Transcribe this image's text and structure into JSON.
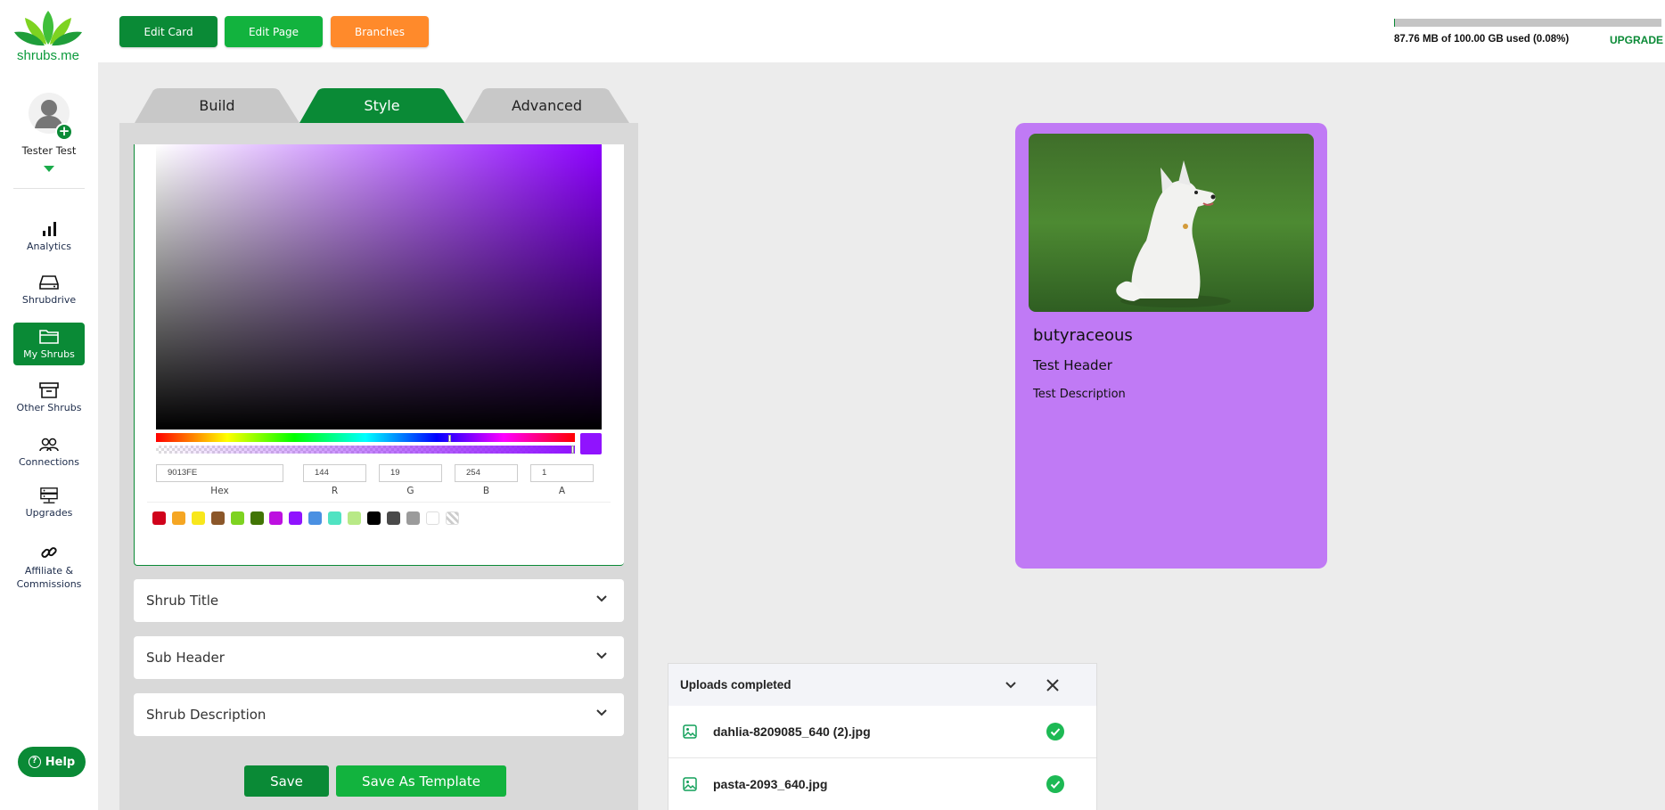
{
  "brand": {
    "logo_text": "shrubs.me"
  },
  "profile": {
    "name": "Tester Test"
  },
  "sidebar": {
    "items": [
      {
        "label": "Analytics"
      },
      {
        "label": "Shrubdrive"
      },
      {
        "label": "My Shrubs"
      },
      {
        "label": "Other Shrubs"
      },
      {
        "label": "Connections"
      },
      {
        "label": "Upgrades"
      },
      {
        "label": "Affiliate &",
        "label2": "Commissions"
      }
    ],
    "help_label": "Help"
  },
  "toolbar": {
    "edit_card": "Edit Card",
    "edit_page": "Edit Page",
    "branches": "Branches"
  },
  "storage": {
    "text": "87.76 MB of 100.00 GB used (0.08%)",
    "used_fraction": 0.0008,
    "upgrade_label": "UPGRADE"
  },
  "tabs": [
    {
      "label": "Build"
    },
    {
      "label": "Style"
    },
    {
      "label": "Advanced"
    }
  ],
  "color_picker": {
    "hex": "9013FE",
    "r": "144",
    "g": "19",
    "b": "254",
    "a": "1",
    "labels": {
      "hex": "Hex",
      "r": "R",
      "g": "G",
      "b": "B",
      "a": "A"
    },
    "selected_color": "#9013FE",
    "preset_colors": [
      "#D0021B",
      "#F5A623",
      "#F8E71C",
      "#8B572A",
      "#7ED321",
      "#417505",
      "#BD10E0",
      "#9013FE",
      "#4A90E2",
      "#50E3C2",
      "#B8E986",
      "#000000",
      "#4A4A4A",
      "#9B9B9B",
      "#FFFFFF",
      "transparent"
    ]
  },
  "sections": [
    {
      "label": "Shrub Title"
    },
    {
      "label": "Sub Header"
    },
    {
      "label": "Shrub Description"
    }
  ],
  "actions": {
    "save": "Save",
    "save_template": "Save As Template"
  },
  "card": {
    "background": "#C07AF5",
    "title": "butyraceous",
    "header": "Test Header",
    "description": "Test Description"
  },
  "uploads": {
    "title": "Uploads completed",
    "files": [
      {
        "name": "dahlia-8209085_640 (2).jpg"
      },
      {
        "name": "pasta-2093_640.jpg"
      }
    ]
  },
  "colors": {
    "brand_green": "#0A8A36",
    "accent_orange": "#FF8A2B",
    "success": "#1DB954"
  }
}
